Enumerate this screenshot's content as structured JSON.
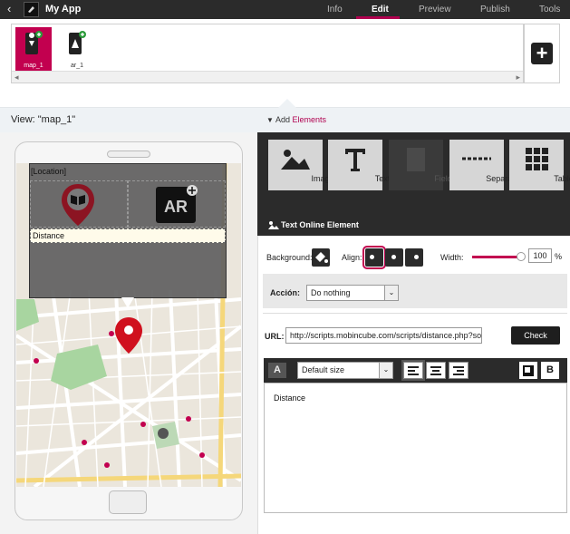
{
  "app": {
    "title": "My App"
  },
  "nav": {
    "tabs": [
      {
        "label": "Info"
      },
      {
        "label": "Edit"
      },
      {
        "label": "Preview"
      },
      {
        "label": "Publish"
      },
      {
        "label": "Tools"
      }
    ],
    "active_tab": "Edit"
  },
  "screens": [
    {
      "label": "map_1",
      "selected": true
    },
    {
      "label": "ar_1",
      "selected": false
    }
  ],
  "view_label": "View: \"map_1\"",
  "add_elements": {
    "prefix": "Add",
    "highlight": "Elements"
  },
  "palette": [
    {
      "label": "Image",
      "icon": "image-icon"
    },
    {
      "label": "Text",
      "icon": "text-icon"
    },
    {
      "label": "Field",
      "icon": "field-icon",
      "disabled": true
    },
    {
      "label": "Separator",
      "icon": "separator-icon"
    },
    {
      "label": "Table",
      "icon": "table-icon"
    }
  ],
  "element_title": "Text Online Element",
  "properties": {
    "background_label": "Background:",
    "align_label": "Align:",
    "width_label": "Width:",
    "width_value": "100",
    "width_unit": "%",
    "width_fraction": 1.0,
    "action_label": "Acción:",
    "action_value": "Do nothing",
    "url_label": "URL:",
    "url_value": "http://scripts.mobincube.com/scripts/distance.php?sou",
    "check_label": "Check",
    "font_size_value": "Default size",
    "editor_text": "Distance"
  },
  "preview": {
    "location_label": "[Location]",
    "distance_label": "Distance"
  },
  "colors": {
    "accent": "#c2004f",
    "dark": "#2b2b2b"
  }
}
